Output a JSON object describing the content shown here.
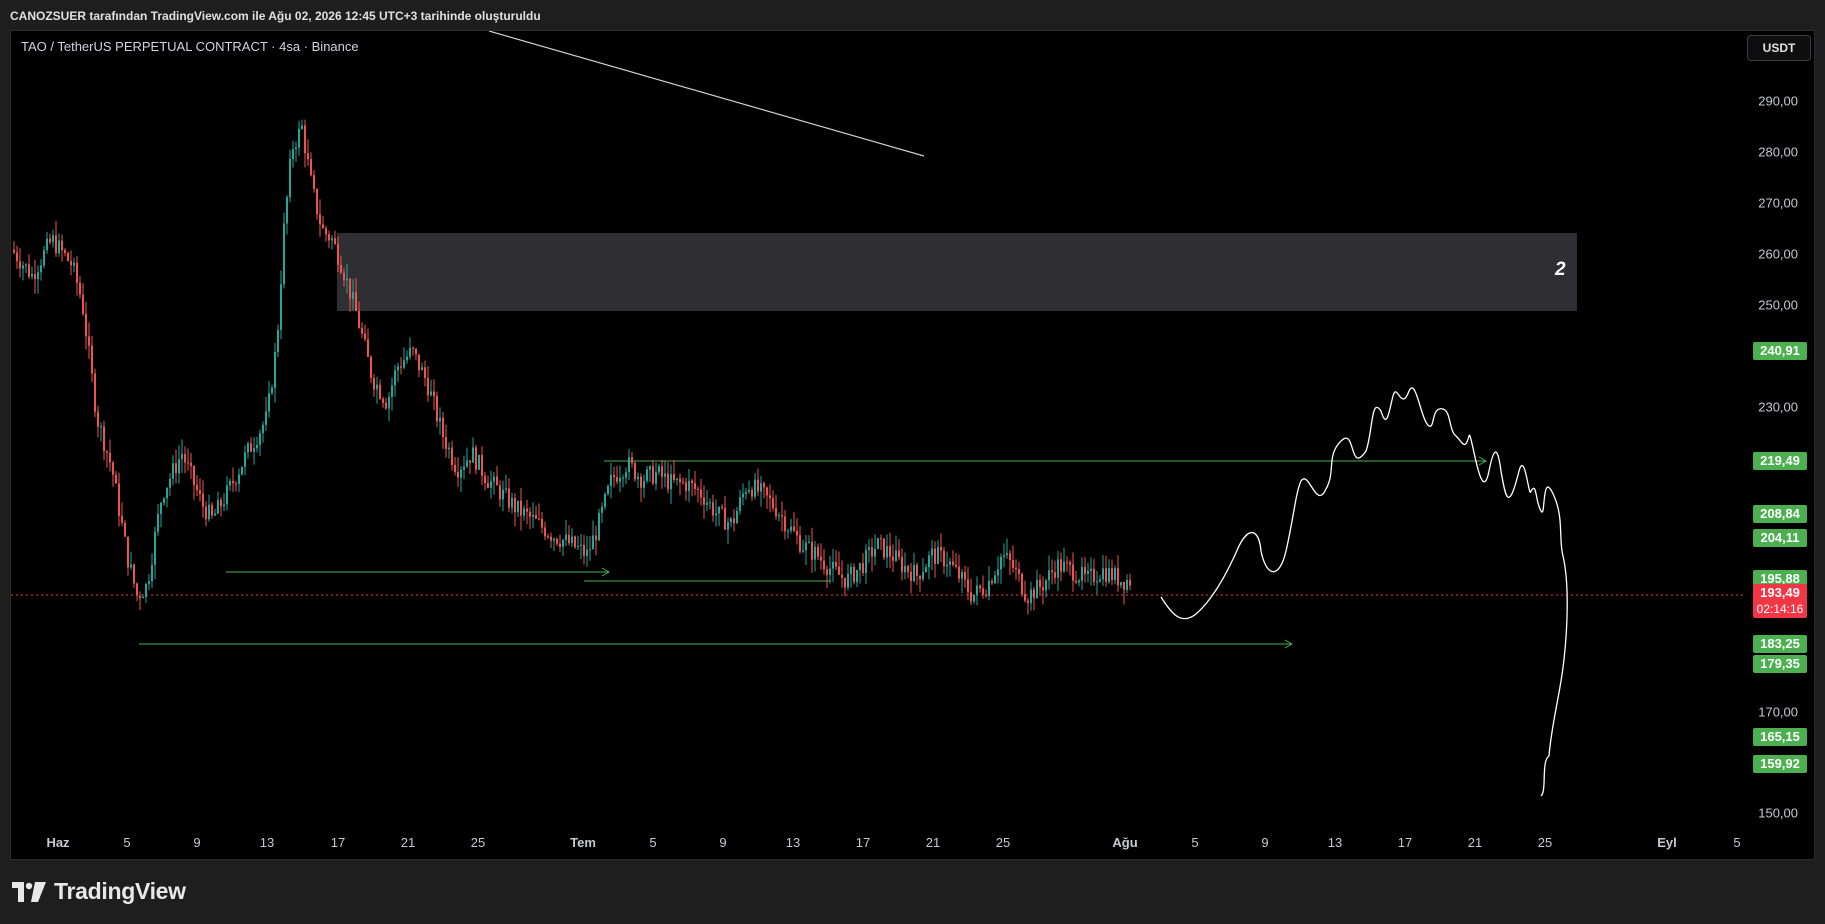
{
  "header": {
    "caption": "CANOZSUER tarafından TradingView.com ile Ağu 02, 2026 12:45 UTC+3 tarihinde oluşturuldu"
  },
  "chart": {
    "symbol": "TAO / TetherUS PERPETUAL CONTRACT · 4sa · Binance",
    "currency": "USDT",
    "zone_label": "2",
    "price_axis": [
      "290,00",
      "280,00",
      "270,00",
      "260,00",
      "250,00",
      "230,00",
      "170,00",
      "150,00"
    ],
    "badges": [
      "240,91",
      "219,49",
      "208,84",
      "204,11",
      "195,88",
      "183,25",
      "179,35",
      "165,15",
      "159,92"
    ],
    "current_price": "193,49",
    "countdown": "02:14:16",
    "time_axis": [
      "Haz",
      "5",
      "9",
      "13",
      "17",
      "21",
      "25",
      "Tem",
      "5",
      "9",
      "13",
      "17",
      "21",
      "25",
      "Ağu",
      "5",
      "9",
      "13",
      "17",
      "21",
      "25",
      "Eyl",
      "5"
    ],
    "colors": {
      "up": "#26a69a",
      "down": "#ef5350",
      "badge": "#4caf50",
      "current": "#f23645",
      "zone": "#2f2f33",
      "level": "#4caf50"
    }
  },
  "brand": {
    "logo_icon": "tradingview-logo-icon",
    "name": "TradingView"
  }
}
